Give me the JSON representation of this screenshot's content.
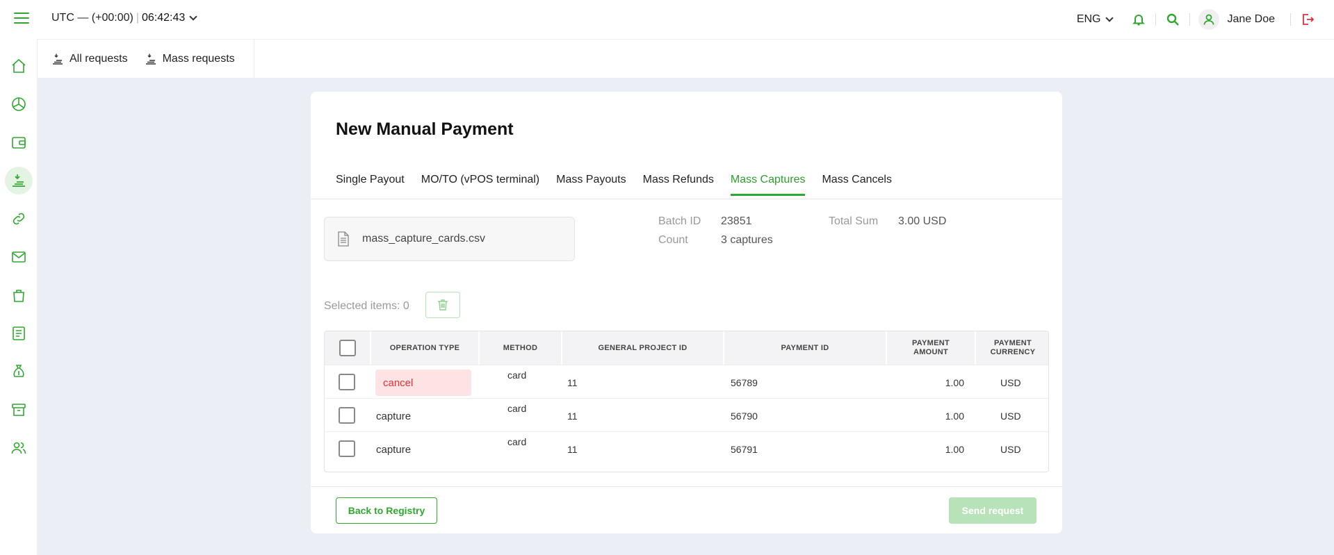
{
  "header": {
    "timezone": "UTC — (+00:00)",
    "time": "06:42:43",
    "language": "ENG",
    "user_name": "Jane Doe"
  },
  "sidebar": {
    "items": [
      {
        "icon": "home-icon"
      },
      {
        "icon": "pie-chart-icon"
      },
      {
        "icon": "wallet-icon"
      },
      {
        "icon": "payments-icon",
        "active": true
      },
      {
        "icon": "link-icon"
      },
      {
        "icon": "mail-icon"
      },
      {
        "icon": "bag-icon"
      },
      {
        "icon": "document-icon"
      },
      {
        "icon": "money-bag-icon"
      },
      {
        "icon": "archive-icon"
      },
      {
        "icon": "users-icon"
      }
    ]
  },
  "subnav": {
    "all_requests": "All requests",
    "mass_requests": "Mass requests"
  },
  "page": {
    "title": "New Manual Payment",
    "tabs": [
      {
        "label": "Single Payout"
      },
      {
        "label": "MO/TO (vPOS terminal)"
      },
      {
        "label": "Mass Payouts"
      },
      {
        "label": "Mass Refunds"
      },
      {
        "label": "Mass Captures",
        "active": true
      },
      {
        "label": "Mass Cancels"
      }
    ],
    "file_name": "mass_capture_cards.csv",
    "batch_id_label": "Batch ID",
    "batch_id": "23851",
    "count_label": "Count",
    "count": "3 captures",
    "total_sum_label": "Total Sum",
    "total_sum": "3.00 USD",
    "selected_items": "Selected items: 0"
  },
  "table": {
    "headers": [
      "OPERATION TYPE",
      "METHOD",
      "GENERAL PROJECT ID",
      "PAYMENT ID",
      "PAYMENT AMOUNT",
      "PAYMENT CURRENCY"
    ],
    "rows": [
      {
        "operation_type": "cancel",
        "error": true,
        "method": "card",
        "project_id": "11",
        "payment_id": "56789",
        "amount": "1.00",
        "currency": "USD"
      },
      {
        "operation_type": "capture",
        "error": false,
        "method": "card",
        "project_id": "11",
        "payment_id": "56790",
        "amount": "1.00",
        "currency": "USD"
      },
      {
        "operation_type": "capture",
        "error": false,
        "method": "card",
        "project_id": "11",
        "payment_id": "56791",
        "amount": "1.00",
        "currency": "USD"
      }
    ]
  },
  "footer": {
    "back_label": "Back to Registry",
    "send_label": "Send request"
  },
  "colors": {
    "accent": "#2ea82e",
    "error": "#e0303a",
    "error_bg": "#fde3e3",
    "background": "#eceef5"
  }
}
